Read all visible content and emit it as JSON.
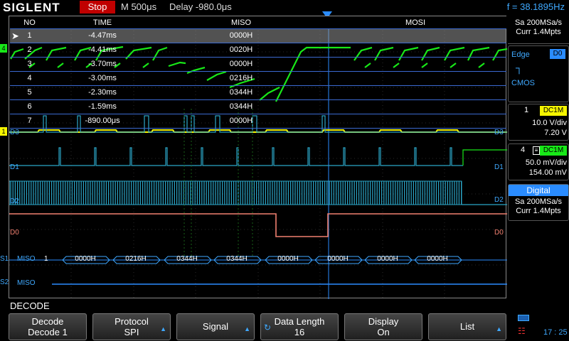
{
  "top": {
    "brand": "SIGLENT",
    "run_state": "Stop",
    "timebase": "M 500μs",
    "delay": "Delay -980.0μs",
    "frequency": "f = 38.1895Hz"
  },
  "sample": {
    "rate": "Sa 200MSa/s",
    "curr": "Curr 1.4Mpts"
  },
  "trigger": {
    "type": "Edge",
    "source": "D0",
    "logic": "CMOS"
  },
  "ch1": {
    "num": "1",
    "coupling": "DC1M",
    "vdiv": "10.0 V/div",
    "offset": "7.20 V"
  },
  "ch4": {
    "num": "4",
    "coupling": "DC1M",
    "vdiv": "50.0 mV/div",
    "offset": "154.00 mV"
  },
  "digital": {
    "title": "Digital",
    "rate": "Sa 200MSa/s",
    "curr": "Curr 1.4Mpts"
  },
  "table": {
    "headers": {
      "no": "NO",
      "time": "TIME",
      "miso": "MISO",
      "mosi": "MOSI"
    },
    "rows": [
      {
        "no": "1",
        "time": "-4.47ms",
        "miso": "0000H"
      },
      {
        "no": "2",
        "time": "-4.41ms",
        "miso": "0020H"
      },
      {
        "no": "3",
        "time": "-3.70ms",
        "miso": "0000H"
      },
      {
        "no": "4",
        "time": "-3.00ms",
        "miso": "0216H"
      },
      {
        "no": "5",
        "time": "-2.30ms",
        "miso": "0344H"
      },
      {
        "no": "6",
        "time": "-1.59ms",
        "miso": "0344H"
      },
      {
        "no": "7",
        "time": "-890.00μs",
        "miso": "0000H"
      }
    ]
  },
  "channel_labels": {
    "d3": "D3",
    "d1": "D1",
    "d2": "D2",
    "d0": "D0",
    "d3r": "D3",
    "d1r": "D1",
    "d2r": "D2",
    "d0r": "D0",
    "s1": "S1",
    "s2": "S2",
    "ch4_marker": "4",
    "ch1_marker": "1"
  },
  "bus1": {
    "name": "MISO",
    "first": "1",
    "values": [
      "0000H",
      "0216H",
      "0344H",
      "0344H",
      "0000H",
      "0000H",
      "0000H",
      "0000H"
    ]
  },
  "bus2": {
    "name": "MISO"
  },
  "bottom": {
    "title": "DECODE",
    "buttons": [
      {
        "l1": "Decode",
        "l2": "Decode 1"
      },
      {
        "l1": "Protocol",
        "l2": "SPI"
      },
      {
        "l1": "Signal",
        "l2": ""
      },
      {
        "l1": "Data Length",
        "l2": "16"
      },
      {
        "l1": "Display",
        "l2": "On"
      },
      {
        "l1": "List",
        "l2": ""
      }
    ],
    "clock": "17 : 25"
  }
}
